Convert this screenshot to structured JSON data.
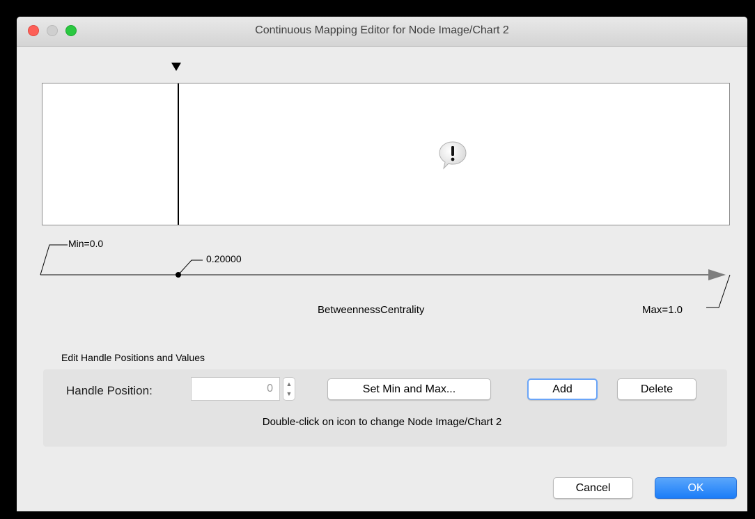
{
  "window": {
    "title": "Continuous Mapping Editor for Node Image/Chart 2"
  },
  "canvas": {
    "handle_value_fraction": 0.2,
    "warning_icon": "exclamation-speech-bubble-icon"
  },
  "axis": {
    "min_label": "Min=0.0",
    "handle_label": "0.20000",
    "attribute_label": "BetweennessCentrality",
    "max_label": "Max=1.0"
  },
  "edit_section": {
    "title": "Edit Handle Positions and Values",
    "handle_position_label": "Handle Position:",
    "handle_position_value": "0",
    "set_min_max_label": "Set Min and Max...",
    "add_label": "Add",
    "delete_label": "Delete",
    "hint": "Double-click on icon to change Node Image/Chart 2"
  },
  "footer": {
    "cancel_label": "Cancel",
    "ok_label": "OK"
  },
  "colors": {
    "ok_button": "#1b7df8",
    "focus_ring": "#6aa5f8",
    "close": "#fd5f57",
    "maximize": "#2ac840"
  }
}
